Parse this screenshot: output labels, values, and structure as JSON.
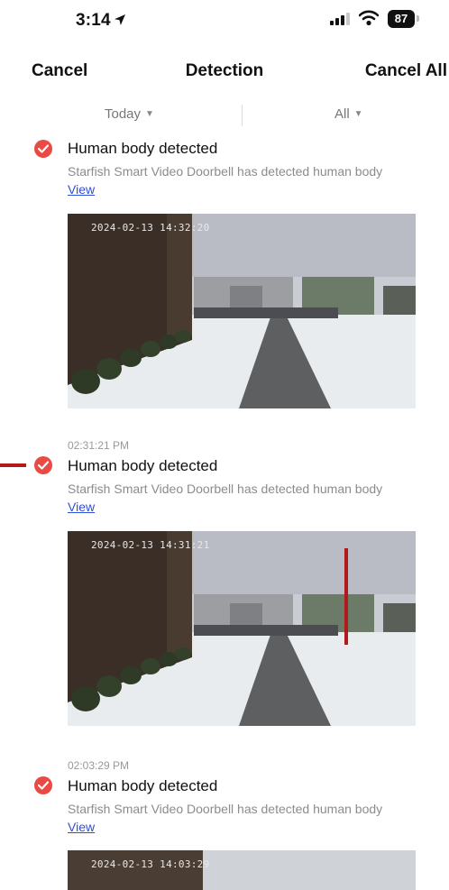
{
  "status_bar": {
    "time": "3:14",
    "battery": "87"
  },
  "nav": {
    "cancel": "Cancel",
    "title": "Detection",
    "cancel_all": "Cancel All"
  },
  "filters": {
    "date": "Today",
    "type": "All"
  },
  "events": [
    {
      "time": "",
      "title": "Human body detected",
      "description": "Starfish Smart Video Doorbell has detected human body",
      "link": "View",
      "snapshot_timestamp": "2024-02-13 14:32:20"
    },
    {
      "time": "02:31:21 PM",
      "title": "Human body detected",
      "description": "Starfish Smart Video Doorbell has detected human body",
      "link": "View",
      "snapshot_timestamp": "2024-02-13 14:31:21"
    },
    {
      "time": "02:03:29 PM",
      "title": "Human body detected",
      "description": "Starfish Smart Video Doorbell has detected human body",
      "link": "View",
      "snapshot_timestamp": "2024-02-13 14:03:29"
    }
  ],
  "icons": {
    "location": "location-arrow-icon",
    "signal": "cellular-signal-icon",
    "wifi": "wifi-icon",
    "check": "check-circle-icon",
    "caret": "caret-down-icon"
  },
  "colors": {
    "check_red": "#e94a43",
    "link_blue": "#2f4fd6",
    "annotation_red": "#b01a1a"
  }
}
